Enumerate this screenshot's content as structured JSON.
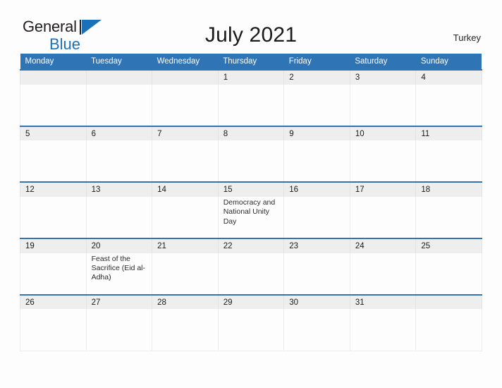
{
  "brand": {
    "name_top": "General",
    "name_bottom": "Blue",
    "flag_color": "#1b71b8",
    "text_color": "#231f20"
  },
  "header": {
    "title": "July 2021",
    "country": "Turkey"
  },
  "theme": {
    "header_blue": "#2f74b5",
    "date_row_gray": "#eeeeee",
    "page_background": "#fdfdfd",
    "body_text": "#1a1a1a"
  },
  "calendar": {
    "month": "July",
    "year": "2021",
    "weekday_headers": [
      "Monday",
      "Tuesday",
      "Wednesday",
      "Thursday",
      "Friday",
      "Saturday",
      "Sunday"
    ],
    "weeks": [
      {
        "dates": [
          "",
          "",
          "",
          "1",
          "2",
          "3",
          "4"
        ],
        "events": [
          "",
          "",
          "",
          "",
          "",
          "",
          ""
        ]
      },
      {
        "dates": [
          "5",
          "6",
          "7",
          "8",
          "9",
          "10",
          "11"
        ],
        "events": [
          "",
          "",
          "",
          "",
          "",
          "",
          ""
        ]
      },
      {
        "dates": [
          "12",
          "13",
          "14",
          "15",
          "16",
          "17",
          "18"
        ],
        "events": [
          "",
          "",
          "",
          "Democracy and National Unity Day",
          "",
          "",
          ""
        ]
      },
      {
        "dates": [
          "19",
          "20",
          "21",
          "22",
          "23",
          "24",
          "25"
        ],
        "events": [
          "",
          "Feast of the Sacrifice (Eid al-Adha)",
          "",
          "",
          "",
          "",
          ""
        ]
      },
      {
        "dates": [
          "26",
          "27",
          "28",
          "29",
          "30",
          "31",
          ""
        ],
        "events": [
          "",
          "",
          "",
          "",
          "",
          "",
          ""
        ]
      }
    ]
  }
}
